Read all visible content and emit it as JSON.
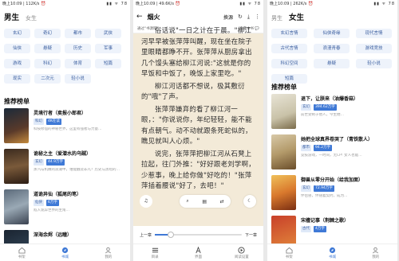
{
  "screen1": {
    "status": {
      "left": "晚上10:09 | 112K/s ⏰",
      "right": "▮▮ ᯤ 78"
    },
    "gender_tabs": [
      {
        "label": "男生",
        "active": true
      },
      {
        "label": "女生",
        "active": false
      }
    ],
    "chips": [
      "玄幻",
      "奇幻",
      "都市",
      "武侠",
      "仙侠",
      "悬疑",
      "历史",
      "军事",
      "游戏",
      "科幻",
      "体育",
      "短篇",
      "现实",
      "二次元",
      "轻小说"
    ],
    "section_title": "推荐榜单",
    "books": [
      {
        "title": "灵境行者（卖报小郎君）",
        "tag1": "科幻",
        "tag2": "4K在读",
        "desc": "科技修仙的神秘世界，这里有强者与力量…"
      },
      {
        "title": "诡秘之主（爱潜水的乌贼）",
        "tag1": "玄幻",
        "tag2": "44.9万字",
        "desc": "蒸汽与机械的浪潮中，谁能触及非凡？历史与黑暗的…"
      },
      {
        "title": "道诡异仙（狐尾的笔）",
        "tag1": "仙侠",
        "tag2": "6万字",
        "desc": "陷入诡异世界的主角…"
      },
      {
        "title": "深海余烬（远瞳）",
        "tag1": "",
        "tag2": "",
        "desc": ""
      }
    ],
    "nav": [
      {
        "label": "书架",
        "active": false
      },
      {
        "label": "书城",
        "active": true
      },
      {
        "label": "我的",
        "active": false
      }
    ]
  },
  "screen2": {
    "status": {
      "left": "晚上10:09 | 49.6K/s ⏰",
      "right": "▮▮ ᯤ 78"
    },
    "back_icon": "back-arrow",
    "title": "烟火",
    "change_source": "换源",
    "subline_left": "通过\"书源网\"",
    "subline_right": "查看本书 💬",
    "paragraphs": [
      "俗话说\"一日之计在于晨。\"柳江河早早被张萍萍叫醒，现在坐在院子里眼睛都睁不开。张萍萍从厨房拿出几个馒头塞给柳江河说:\"这就是你的早饭和中饭了，晚饭上家里吃。\"",
      "柳江河话都不想说，极其敷衍的\"哦\"了声。",
      "张萍萍嫌弃的看了柳江河一眼，：\"你说说你，年纪轻轻，能不能有点朝气。动不动就跟条死蛇似的，瞧见就叫人心烦。\"",
      "说完，张萍萍把柳江河从石凳上拉起，往门外推：\"好好跟老刘学啊，少惹事，晚上给你做\"好吃的！\"张萍萍插着腰说\"好了，去吧！\""
    ],
    "prev_chapter": "上一章",
    "next_chapter": "下一章",
    "progress": 0.18,
    "nav": [
      {
        "label": "目录"
      },
      {
        "label": "界面"
      },
      {
        "label": "阅读设置"
      }
    ]
  },
  "screen3": {
    "status": {
      "left": "晚上10:09 | 262K/s ⏰",
      "right": "▮▮ ᯤ 78"
    },
    "gender_tabs": [
      {
        "label": "男生",
        "active": false
      },
      {
        "label": "女生",
        "active": true
      }
    ],
    "chips": [
      "玄幻言情",
      "仙侠奇缘",
      "现代言情",
      "古代言情",
      "浪漫青春",
      "游戏竞技",
      "科幻空间",
      "悬疑",
      "轻小说",
      "短篇"
    ],
    "section_title": "推荐榜单",
    "books": [
      {
        "title": "退下，让朕来（油爆香菇）",
        "tag1": "玄幻",
        "tag2": "394.62万字",
        "desc": "前世受制于他人，今生她…"
      },
      {
        "title": "她把全球真界卷哭了（青铁散人）",
        "tag1": "都市",
        "tag2": "94.2万字",
        "desc": "竞技游戏，一时间，无CP! 女人也能…"
      },
      {
        "title": "御兽从零分开始（给我加面）",
        "tag1": "玄幻",
        "tag2": "72.94万字",
        "desc": "伴侣兽，伴随着契约，成为…"
      },
      {
        "title": "宋檀记事（荆棘之歌）",
        "tag1": "古代",
        "tag2": "4万字",
        "desc": ""
      }
    ],
    "nav": [
      {
        "label": "书架",
        "active": false
      },
      {
        "label": "书城",
        "active": true
      },
      {
        "label": "我的",
        "active": false
      }
    ]
  }
}
